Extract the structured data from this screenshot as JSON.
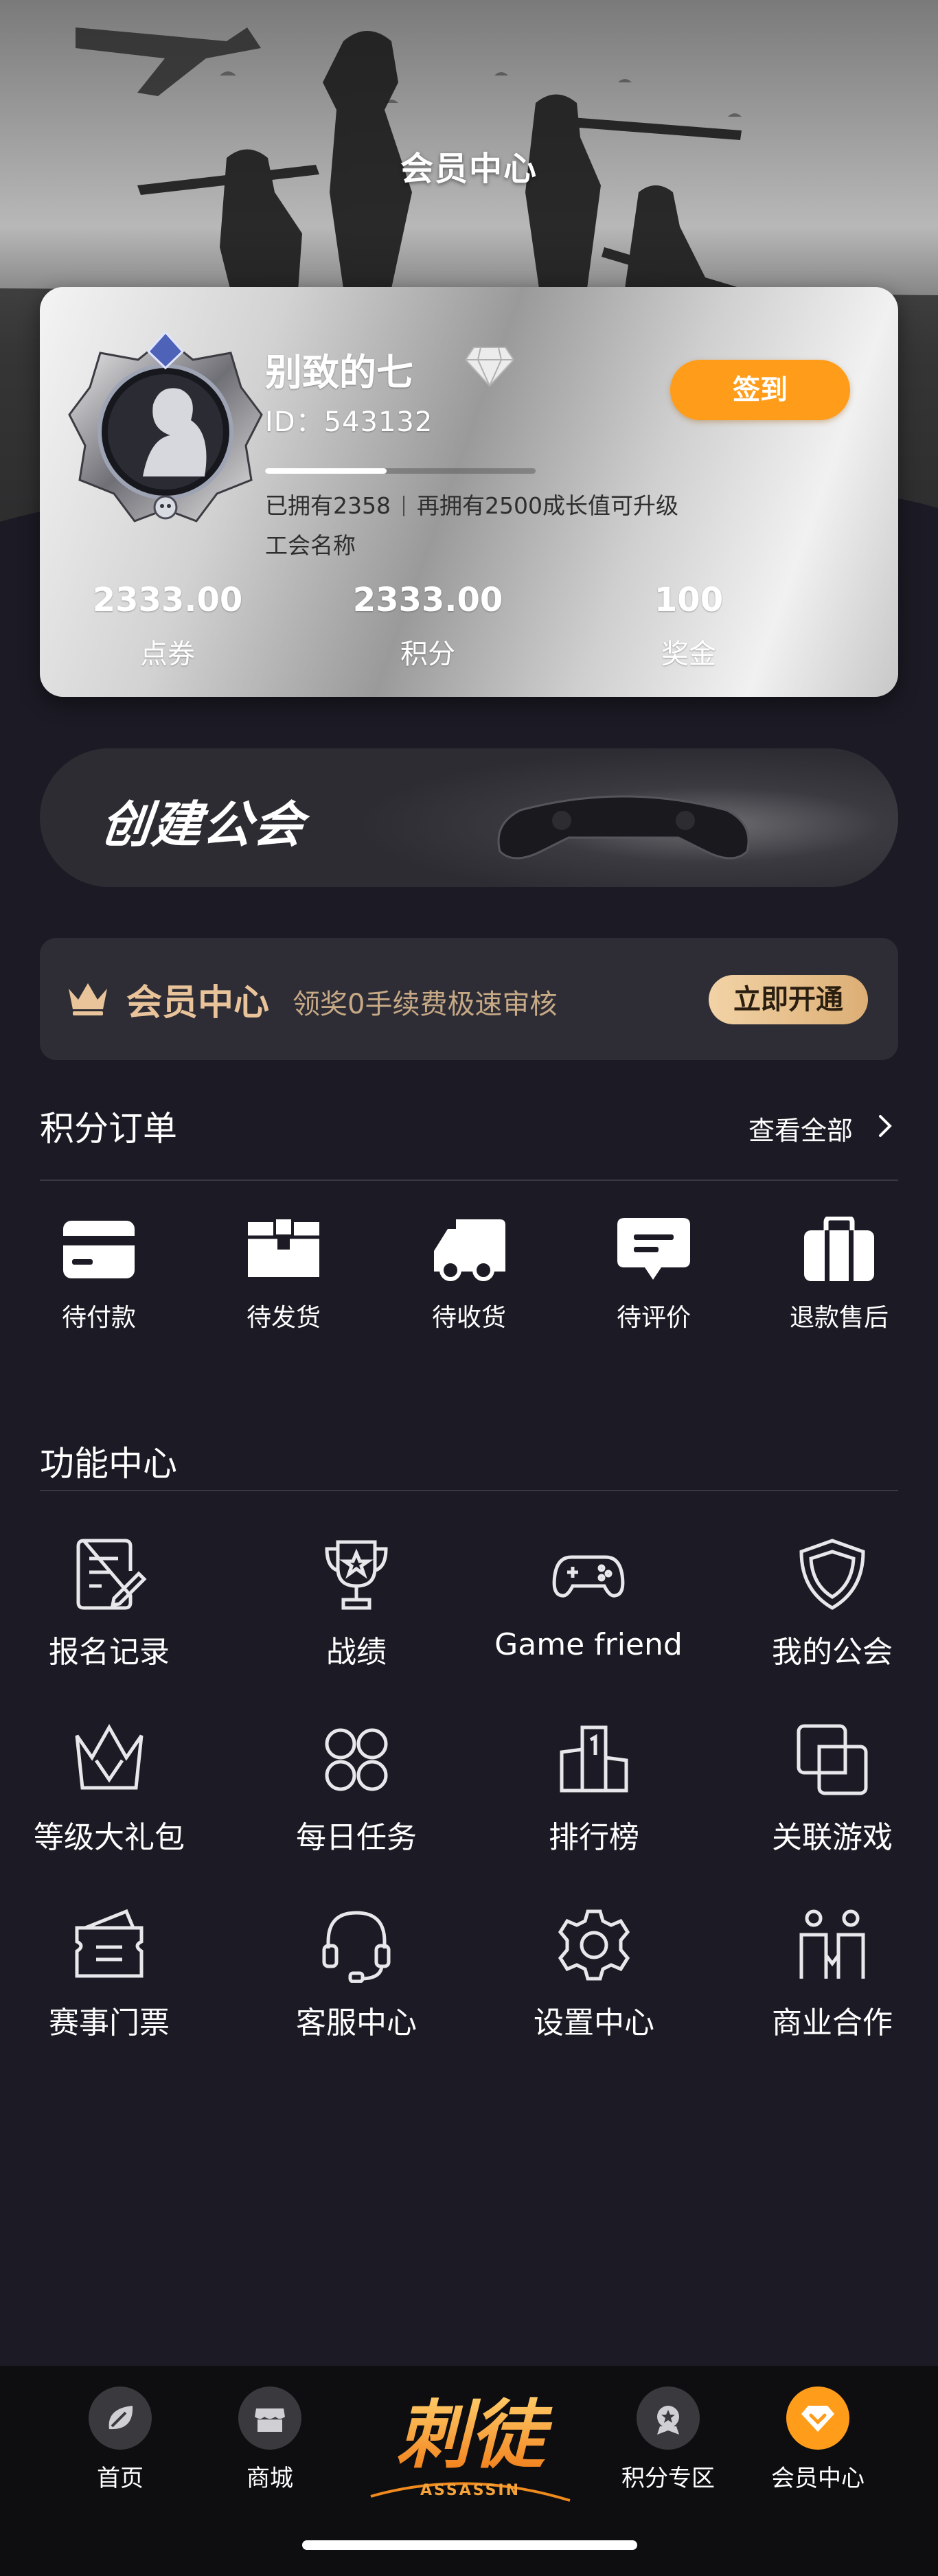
{
  "page": {
    "title": "会员中心"
  },
  "profile": {
    "username": "别致的七",
    "id_label": "ID：",
    "id_value": "543132",
    "checkin_label": "签到",
    "growth_progress": 0.45,
    "owned_text": "已拥有2358",
    "upgrade_text": "再拥有2500成长值可升级",
    "guild_name": "工会名称",
    "stats": [
      {
        "value": "2333.00",
        "label": "点券"
      },
      {
        "value": "2333.00",
        "label": "积分"
      },
      {
        "value": "100",
        "label": "奖金"
      }
    ]
  },
  "create_guild": {
    "title": "创建公会"
  },
  "member_banner": {
    "title": "会员中心",
    "subtitle": "领奖0手续费极速审核",
    "button": "立即开通",
    "colors": {
      "gold": "#e9c49a",
      "button_start": "#f2d3a6",
      "button_end": "#dcae75"
    }
  },
  "orders": {
    "title": "积分订单",
    "view_all": "查看全部",
    "items": [
      {
        "label": "待付款",
        "icon": "card-icon"
      },
      {
        "label": "待发货",
        "icon": "box-icon"
      },
      {
        "label": "待收货",
        "icon": "truck-icon"
      },
      {
        "label": "待评价",
        "icon": "comment-icon"
      },
      {
        "label": "退款售后",
        "icon": "bag-icon"
      }
    ]
  },
  "functions": {
    "title": "功能中心",
    "items": [
      {
        "label": "报名记录",
        "icon": "edit-document-icon"
      },
      {
        "label": "战绩",
        "icon": "trophy-icon"
      },
      {
        "label": "Game friend",
        "icon": "gamepad-icon"
      },
      {
        "label": "我的公会",
        "icon": "shield-icon"
      },
      {
        "label": "等级大礼包",
        "icon": "crown-icon"
      },
      {
        "label": "每日任务",
        "icon": "grid-icon"
      },
      {
        "label": "排行榜",
        "icon": "podium-icon"
      },
      {
        "label": "关联游戏",
        "icon": "link-squares-icon"
      },
      {
        "label": "赛事门票",
        "icon": "ticket-icon"
      },
      {
        "label": "客服中心",
        "icon": "headset-icon"
      },
      {
        "label": "设置中心",
        "icon": "settings-icon"
      },
      {
        "label": "商业合作",
        "icon": "people-icon"
      }
    ]
  },
  "tabbar": {
    "items": [
      {
        "label": "首页",
        "icon": "home-leaf-icon"
      },
      {
        "label": "商城",
        "icon": "store-icon"
      },
      {
        "label": "积分专区",
        "icon": "points-medal-icon"
      },
      {
        "label": "会员中心",
        "icon": "member-diamond-icon"
      }
    ],
    "logo_alt": "ASSASSIN",
    "logo_text": "刺徒",
    "accent": "#ff9d1b"
  }
}
